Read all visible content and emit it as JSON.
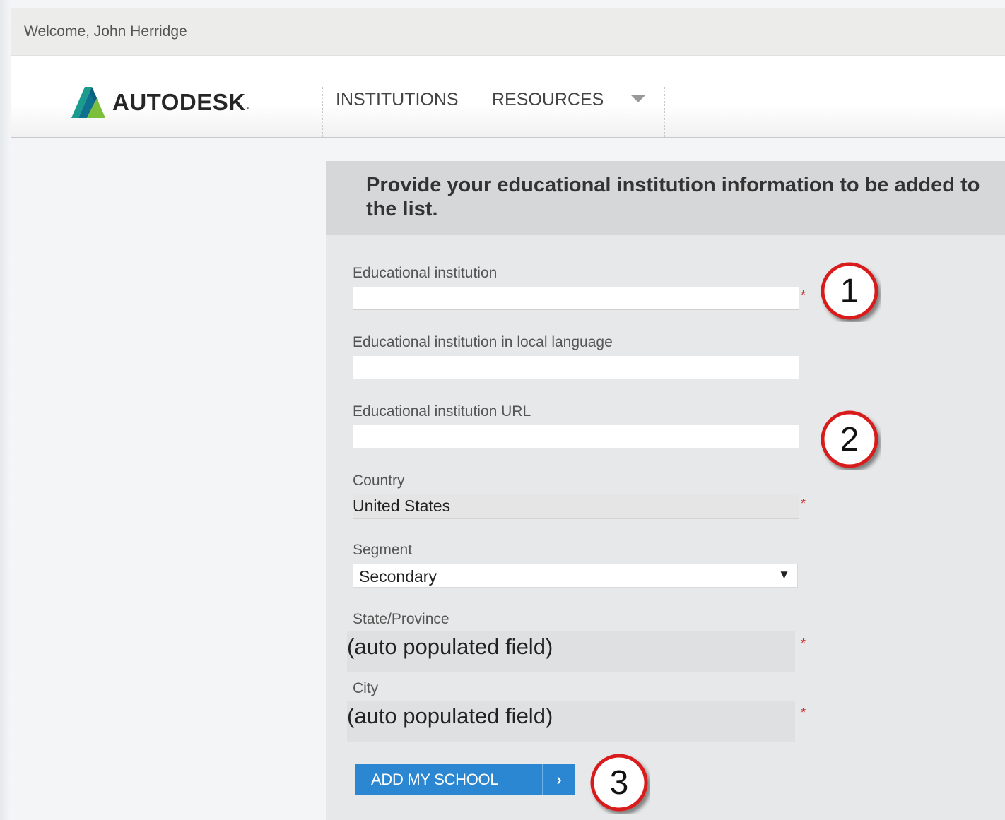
{
  "welcome": {
    "text": "Welcome, John Herridge"
  },
  "brand": {
    "name": "AUTODESK",
    "dot": "."
  },
  "nav": {
    "items": [
      {
        "label": "INSTITUTIONS"
      },
      {
        "label": "RESOURCES"
      }
    ],
    "resources_menu_icon": "caret-down-icon"
  },
  "form": {
    "title": "Provide your educational institution information to be added to the list.",
    "fields": {
      "institution": {
        "label": "Educational institution",
        "value": "",
        "required_mark": "*"
      },
      "local_name": {
        "label": "Educational institution in local language",
        "value": ""
      },
      "url": {
        "label": "Educational institution URL",
        "value": ""
      },
      "country": {
        "label": "Country",
        "value": "United States",
        "required_mark": "*"
      },
      "segment": {
        "label": "Segment",
        "value": "Secondary",
        "arrow": "▼"
      },
      "state": {
        "label": "State/Province",
        "value": "(auto populated field)",
        "required_mark": "*"
      },
      "city": {
        "label": "City",
        "value": "(auto populated field)",
        "required_mark": "*"
      }
    },
    "submit": {
      "label": "ADD MY SCHOOL",
      "arrow": "›"
    }
  },
  "callouts": [
    {
      "number": "1"
    },
    {
      "number": "2"
    },
    {
      "number": "3"
    }
  ],
  "colors": {
    "accent_blue": "#2b87d1",
    "callout_red": "#d81e1e",
    "required_red": "#d32f2f"
  }
}
